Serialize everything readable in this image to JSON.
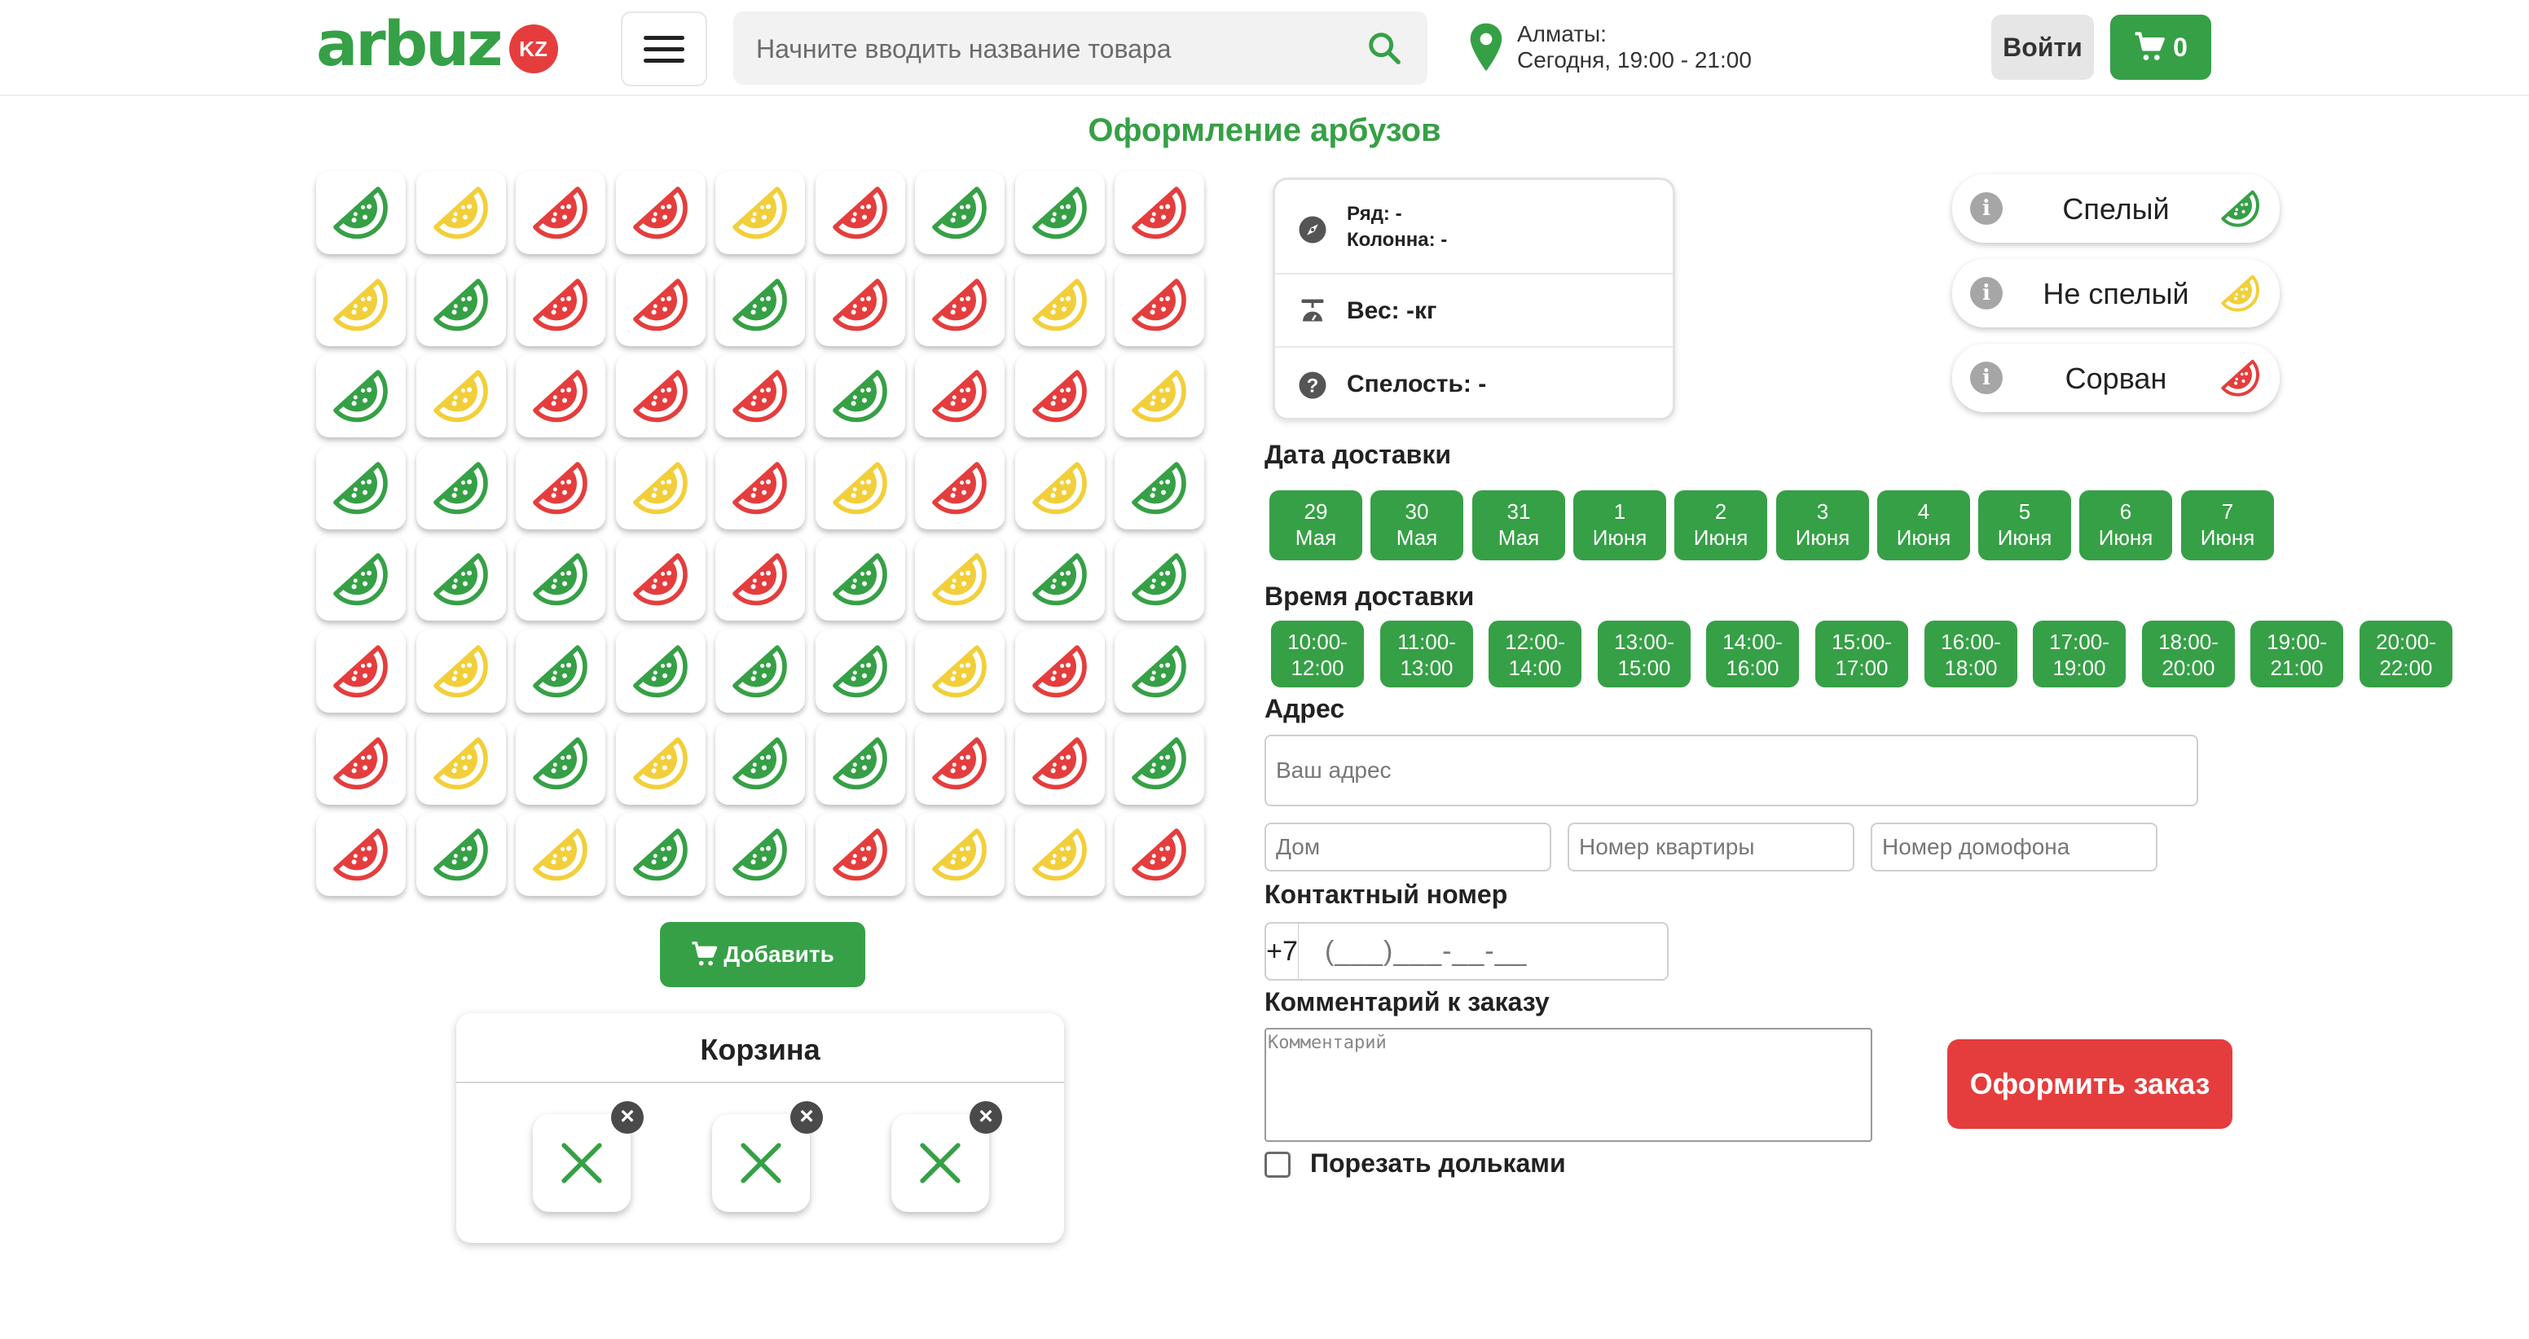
{
  "header": {
    "logo_text": "arbuz",
    "logo_badge": "KZ",
    "search_placeholder": "Начните вводить название товара",
    "location_city": "Алматы:",
    "location_time": "Сегодня, 19:00 - 21:00",
    "login_label": "Войти",
    "cart_count": "0"
  },
  "page_title": "Оформление арбузов",
  "colors": {
    "green": "#36a046",
    "yellow": "#f2cf3a",
    "red": "#e53d3d"
  },
  "grid": {
    "rows": [
      [
        "green",
        "yellow",
        "red",
        "red",
        "yellow",
        "red",
        "green",
        "green",
        "red"
      ],
      [
        "yellow",
        "green",
        "red",
        "red",
        "green",
        "red",
        "red",
        "yellow",
        "red"
      ],
      [
        "green",
        "yellow",
        "red",
        "red",
        "red",
        "green",
        "red",
        "red",
        "yellow"
      ],
      [
        "green",
        "green",
        "red",
        "yellow",
        "red",
        "yellow",
        "red",
        "yellow",
        "green"
      ],
      [
        "green",
        "green",
        "green",
        "red",
        "red",
        "green",
        "yellow",
        "green",
        "green"
      ],
      [
        "red",
        "yellow",
        "green",
        "green",
        "green",
        "green",
        "yellow",
        "red",
        "green"
      ],
      [
        "red",
        "yellow",
        "green",
        "yellow",
        "green",
        "green",
        "red",
        "red",
        "green"
      ],
      [
        "red",
        "green",
        "yellow",
        "green",
        "green",
        "red",
        "yellow",
        "yellow",
        "red"
      ]
    ]
  },
  "add_button_label": "Добавить",
  "basket": {
    "title": "Корзина",
    "slots": [
      "empty-slot",
      "empty-slot",
      "empty-slot"
    ]
  },
  "info_card": {
    "row_label": "Ряд: -",
    "column_label": "Колонна: -",
    "weight_label": "Вес: -кг",
    "ripeness_label": "Спелость: -"
  },
  "legend": [
    {
      "label": "Спелый",
      "color": "green",
      "info_icon": "i"
    },
    {
      "label": "Не спелый",
      "color": "yellow",
      "info_icon": "i"
    },
    {
      "label": "Сорван",
      "color": "red",
      "info_icon": "i"
    }
  ],
  "delivery": {
    "date_label": "Дата доставки",
    "dates": [
      {
        "day": "29",
        "month": "Мая"
      },
      {
        "day": "30",
        "month": "Мая"
      },
      {
        "day": "31",
        "month": "Мая"
      },
      {
        "day": "1",
        "month": "Июня"
      },
      {
        "day": "2",
        "month": "Июня"
      },
      {
        "day": "3",
        "month": "Июня"
      },
      {
        "day": "4",
        "month": "Июня"
      },
      {
        "day": "5",
        "month": "Июня"
      },
      {
        "day": "6",
        "month": "Июня"
      },
      {
        "day": "7",
        "month": "Июня"
      }
    ],
    "time_label": "Время доставки",
    "times": [
      {
        "from": "10:00-",
        "to": "12:00"
      },
      {
        "from": "11:00-",
        "to": "13:00"
      },
      {
        "from": "12:00-",
        "to": "14:00"
      },
      {
        "from": "13:00-",
        "to": "15:00"
      },
      {
        "from": "14:00-",
        "to": "16:00"
      },
      {
        "from": "15:00-",
        "to": "17:00"
      },
      {
        "from": "16:00-",
        "to": "18:00"
      },
      {
        "from": "17:00-",
        "to": "19:00"
      },
      {
        "from": "18:00-",
        "to": "20:00"
      },
      {
        "from": "19:00-",
        "to": "21:00"
      },
      {
        "from": "20:00-",
        "to": "22:00"
      }
    ]
  },
  "address": {
    "label": "Адрес",
    "address_placeholder": "Ваш адрес",
    "house_placeholder": "Дом",
    "apartment_placeholder": "Номер квартиры",
    "intercom_placeholder": "Номер домофона"
  },
  "contact": {
    "label": "Контактный номер",
    "prefix": "+7",
    "mask": "(___)___-__-__"
  },
  "comment": {
    "label": "Комментарий к заказу",
    "placeholder": "Комментарий"
  },
  "cut_slices_label": "Порезать дольками",
  "order_button_label": "Оформить заказ"
}
